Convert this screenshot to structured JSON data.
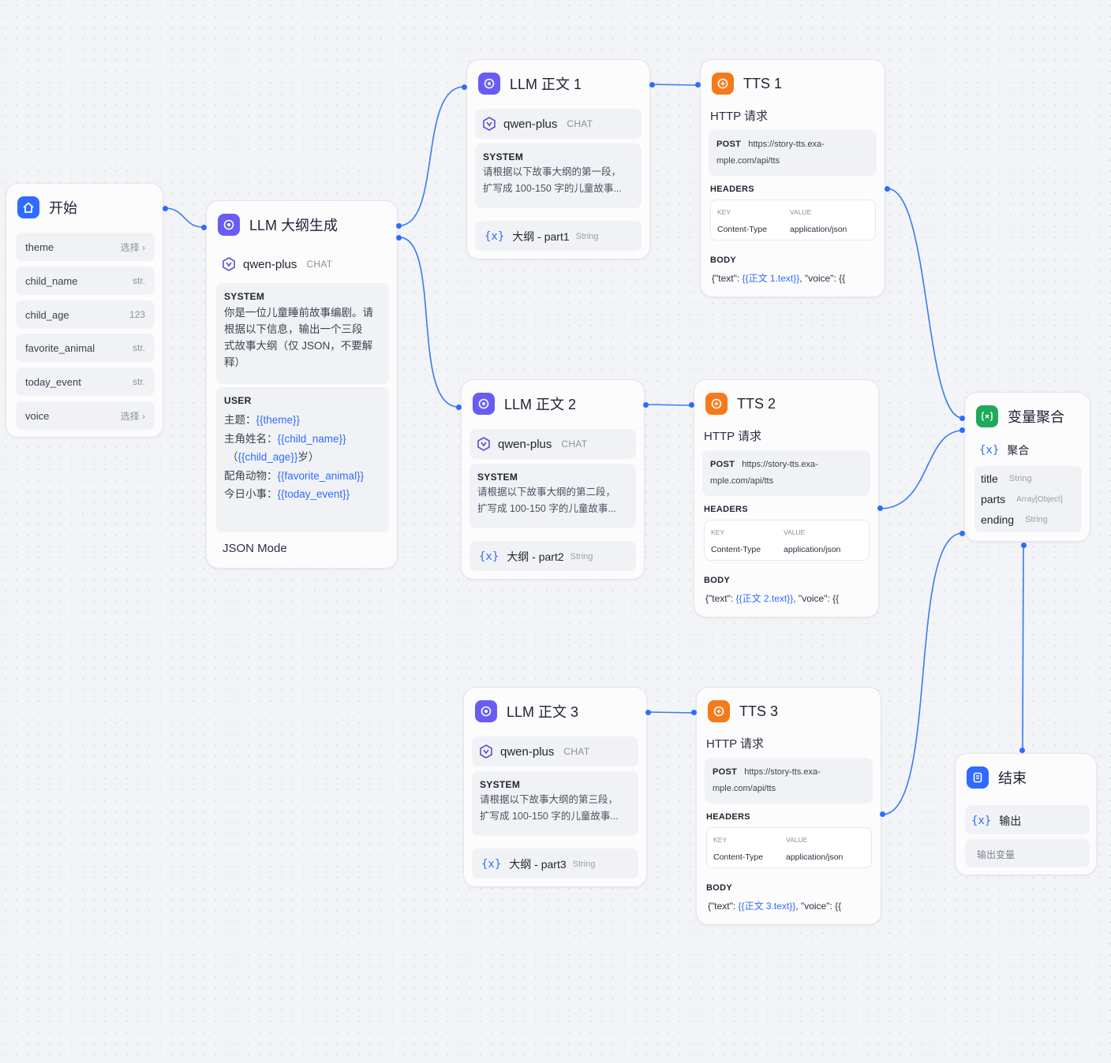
{
  "colors": {
    "accent": "#2e6bff",
    "llm": "#6a5cf2",
    "tts": "#f57a1b",
    "aggregator": "#1eaa58",
    "edge": "#3a7bf0"
  },
  "start": {
    "title": "开始",
    "icon": "home-icon",
    "vars": [
      {
        "name": "theme",
        "type": "选择",
        "chev": "›"
      },
      {
        "name": "child_name",
        "type": "str."
      },
      {
        "name": "child_age",
        "type": "123"
      },
      {
        "name": "favorite_animal",
        "type": "str."
      },
      {
        "name": "today_event",
        "type": "str."
      },
      {
        "name": "voice",
        "type": "选择",
        "chev": "›"
      }
    ]
  },
  "outline": {
    "title": "LLM 大纲生成",
    "model": "qwen-plus",
    "mode": "CHAT",
    "system_label": "SYSTEM",
    "system_lines": [
      "你是一位儿童睡前故事编剧。请",
      "根据以下信息，输出一个三段",
      "式故事大纲（仅 JSON，不要解",
      "释）"
    ],
    "user_label": "USER",
    "user": {
      "l1_label": "主题：",
      "l1_var": "{{theme}}",
      "l2_label": "主角姓名：",
      "l2_var": "{{child_name}}",
      "l3_pre": "（",
      "l3_var": "{{child_age}}",
      "l3_post": "岁）",
      "l4_label": "配角动物：",
      "l4_var": "{{favorite_animal}}",
      "l5_label": "今日小事：",
      "l5_var": "{{today_event}}"
    },
    "json_mode": "JSON Mode"
  },
  "llm1": {
    "title": "LLM 正文 1",
    "model": "qwen-plus",
    "mode": "CHAT",
    "system_label": "SYSTEM",
    "system_lines": [
      "请根据以下故事大纲的第一段，",
      "扩写成 100-150 字的儿童故事..."
    ],
    "var": "{x}",
    "var_label": "大纲 - part1",
    "var_type": "String"
  },
  "llm2": {
    "title": "LLM 正文 2",
    "model": "qwen-plus",
    "mode": "CHAT",
    "system_label": "SYSTEM",
    "system_lines": [
      "请根据以下故事大纲的第二段，",
      "扩写成 100-150 字的儿童故事..."
    ],
    "var": "{x}",
    "var_label": "大纲 - part2",
    "var_type": "String"
  },
  "llm3": {
    "title": "LLM 正文 3",
    "model": "qwen-plus",
    "mode": "CHAT",
    "system_label": "SYSTEM",
    "system_lines": [
      "请根据以下故事大纲的第三段，",
      "扩写成 100-150 字的儿童故事..."
    ],
    "var": "{x}",
    "var_label": "大纲 - part3",
    "var_type": "String"
  },
  "tts1": {
    "title": "TTS 1",
    "subtitle": "HTTP 请求",
    "method": "POST",
    "url1": "https://story-tts.exa-",
    "url2": "mple.com/api/tts",
    "headers_label": "HEADERS",
    "key_h": "KEY",
    "value_h": "VALUE",
    "key": "Content-Type",
    "value": "application/json",
    "body_label": "BODY",
    "body_pre": "{\"text\": ",
    "body_var": "{{正文 1.text}}",
    "body_post": ", \"voice\": {{"
  },
  "tts2": {
    "title": "TTS 2",
    "subtitle": "HTTP 请求",
    "method": "POST",
    "url1": "https://story-tts.exa-",
    "url2": "mple.com/api/tts",
    "headers_label": "HEADERS",
    "key_h": "KEY",
    "value_h": "VALUE",
    "key": "Content-Type",
    "value": "application/json",
    "body_label": "BODY",
    "body_pre": "{\"text\": ",
    "body_var": "{{正文 2.text}}",
    "body_post": ", \"voice\": {{"
  },
  "tts3": {
    "title": "TTS 3",
    "subtitle": "HTTP 请求",
    "method": "POST",
    "url1": "https://story-tts.exa-",
    "url2": "mple.com/api/tts",
    "headers_label": "HEADERS",
    "key_h": "KEY",
    "value_h": "VALUE",
    "key": "Content-Type",
    "value": "application/json",
    "body_label": "BODY",
    "body_pre": "{\"text\": ",
    "body_var": "{{正文 3.text}}",
    "body_post": ", \"voice\": {{"
  },
  "aggregator": {
    "title": "变量聚合",
    "group_icon": "{x}",
    "group_label": "聚合",
    "fields": [
      {
        "name": "title",
        "type": "String"
      },
      {
        "name": "parts",
        "type": "Array[Object]"
      },
      {
        "name": "ending",
        "type": "String"
      }
    ]
  },
  "end": {
    "title": "结束",
    "var": "{x}",
    "var_label": "输出",
    "placeholder": "输出变量"
  }
}
